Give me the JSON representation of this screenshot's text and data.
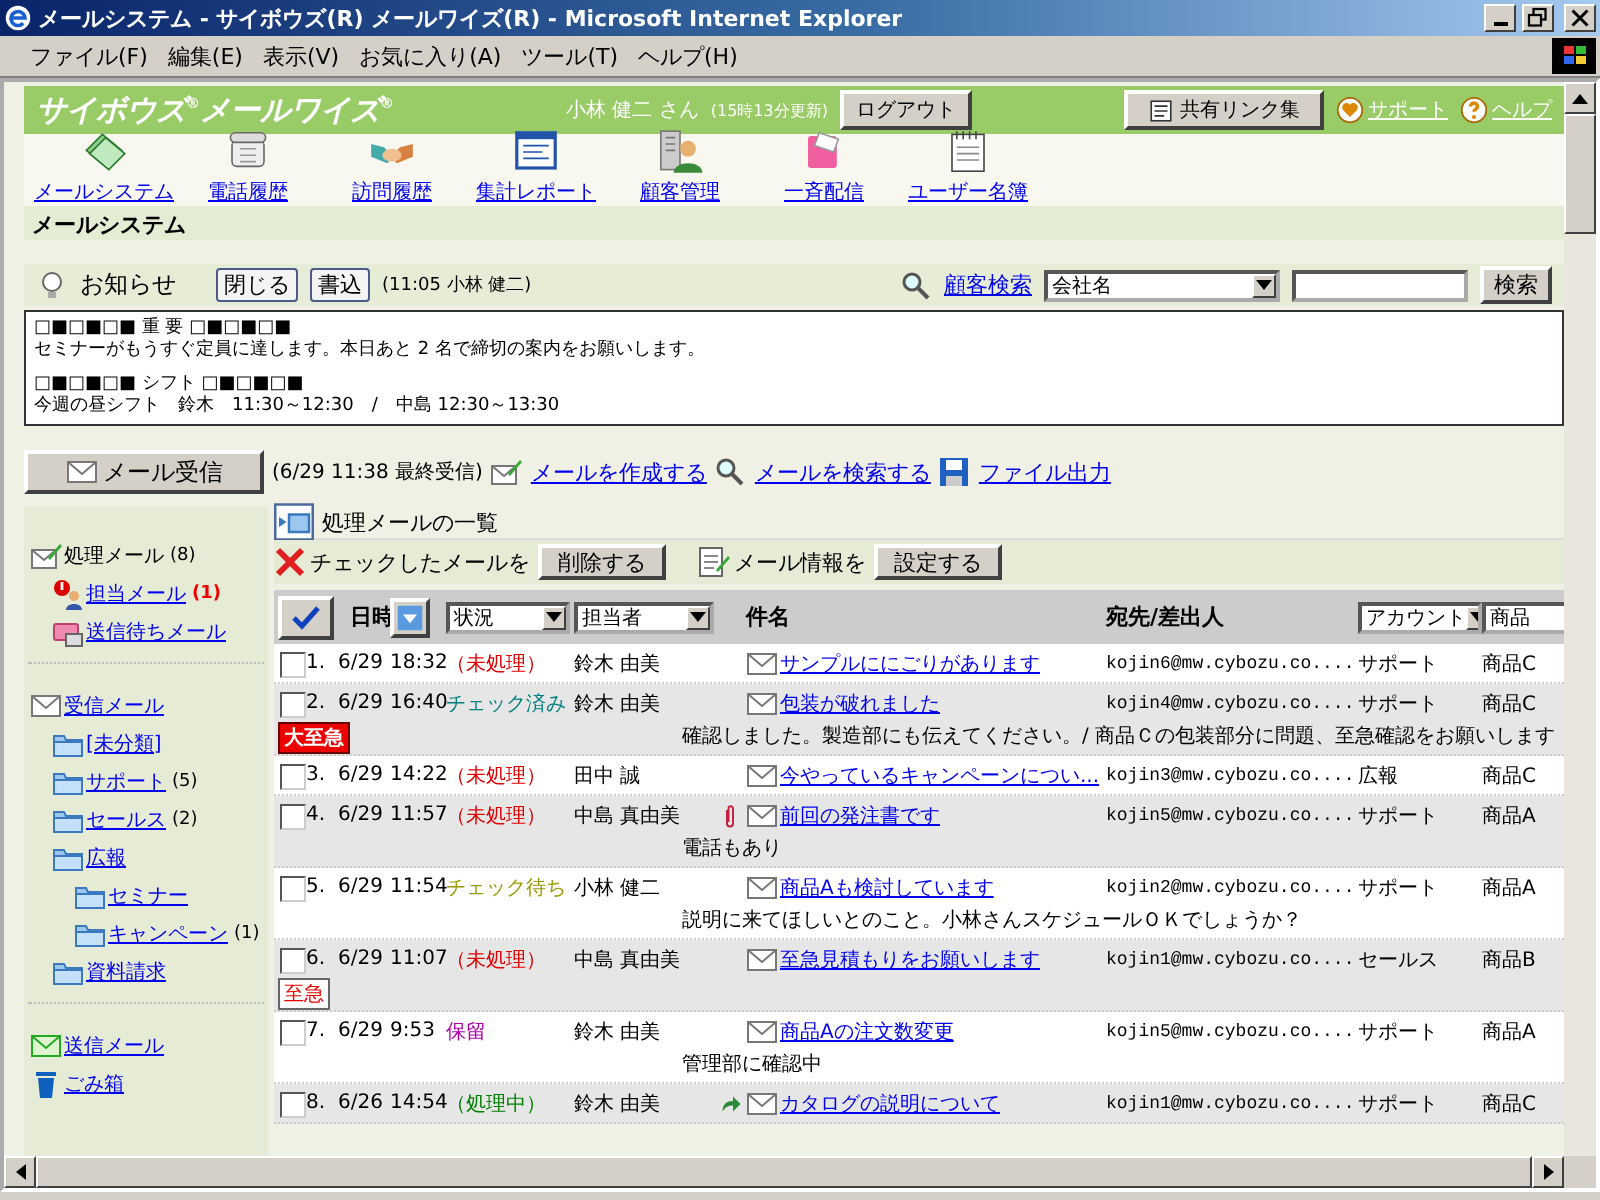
{
  "window": {
    "title": "メールシステム - サイボウズ(R) メールワイズ(R) - Microsoft Internet Explorer"
  },
  "menu": [
    "ファイル(F)",
    "編集(E)",
    "表示(V)",
    "お気に入り(A)",
    "ツール(T)",
    "ヘルプ(H)"
  ],
  "header": {
    "logo": "サイボウズ$^{®}$メールワイズ$^{®}$",
    "user": "小林 健二 さん",
    "updated": "(15時13分更新)",
    "logout": "ログアウト",
    "shared_links": "共有リンク集",
    "support": "サポート",
    "help": "ヘルプ"
  },
  "nav": [
    {
      "label": "メールシステム",
      "kind": "mail"
    },
    {
      "label": "電話履歴",
      "kind": "phone"
    },
    {
      "label": "訪問履歴",
      "kind": "visit"
    },
    {
      "label": "集計レポート",
      "kind": "report"
    },
    {
      "label": "顧客管理",
      "kind": "customer"
    },
    {
      "label": "一斉配信",
      "kind": "broadcast"
    },
    {
      "label": "ユーザー名簿",
      "kind": "users"
    }
  ],
  "section_title": "メールシステム",
  "notice": {
    "title": "お知らせ",
    "close": "閉じる",
    "write": "書込",
    "meta": "(11:05 小林 健二)",
    "paragraphs": [
      [
        "□■□■□■ 重 要 □■□■□■",
        "セミナーがもうすぐ定員に達します。本日あと 2 名で締切の案内をお願いします。"
      ],
      [
        "□■□■□■ シフト □■□■□■",
        "今週の昼シフト　鈴木　11:30～12:30　/　中島 12:30～13:30"
      ]
    ]
  },
  "customer_search": {
    "link": "顧客検索",
    "select": "会社名",
    "button": "検索"
  },
  "actions": {
    "receive": "メール受信",
    "last_received": "(6/29 11:38 最終受信)",
    "compose": "メールを作成する",
    "search": "メールを検索する",
    "export": "ファイル出力"
  },
  "sidebar": {
    "sections": [
      {
        "items": [
          {
            "label": "処理メール",
            "count": "(8)",
            "alert": false,
            "kind": "mail-pen",
            "link": false,
            "children": [
              {
                "label": "担当メール",
                "count": "(1)",
                "alert": true,
                "kind": "person-alert",
                "link": true
              },
              {
                "label": "送信待ちメール",
                "kind": "outbox",
                "link": true
              }
            ]
          }
        ]
      },
      {
        "items": [
          {
            "label": "受信メール",
            "kind": "envelope",
            "link": true,
            "children": [
              {
                "label": "[未分類]",
                "kind": "folder",
                "link": true
              },
              {
                "label": "サポート",
                "count": "(5)",
                "alert": false,
                "kind": "folder",
                "link": true
              },
              {
                "label": "セールス",
                "count": "(2)",
                "alert": false,
                "kind": "folder",
                "link": true
              },
              {
                "label": "広報",
                "kind": "folder",
                "link": true,
                "children": [
                  {
                    "label": "セミナー",
                    "kind": "folder",
                    "link": true
                  },
                  {
                    "label": "キャンペーン",
                    "count": "(1)",
                    "alert": false,
                    "kind": "folder",
                    "link": true
                  }
                ]
              },
              {
                "label": "資料請求",
                "kind": "folder",
                "link": true
              }
            ]
          }
        ]
      },
      {
        "items": [
          {
            "label": "送信メール",
            "kind": "envelope-green",
            "link": true
          },
          {
            "label": "ごみ箱",
            "kind": "trash",
            "link": true
          }
        ]
      }
    ]
  },
  "list": {
    "title": "処理メールの一覧",
    "delete_prefix": "チェックしたメールを",
    "delete_button": "削除する",
    "info_prefix": "メール情報を",
    "set_button": "設定する",
    "columns": {
      "date": "日時",
      "status": "状況",
      "assignee": "担当者",
      "subject": "件名",
      "address": "宛先/差出人",
      "account": "アカウント",
      "product": "商品"
    },
    "rows": [
      {
        "no": "1.",
        "checked": false,
        "date": "6/29",
        "time": "18:32",
        "status": {
          "label": "（未処理）",
          "color": "#e00000"
        },
        "assignee": "鈴木 由美",
        "attachment": false,
        "forwarded": false,
        "subject": "サンプルににごりがあります",
        "address": "kojin6@mw.cybozu.co....",
        "account": "サポート",
        "product": "商品C"
      },
      {
        "no": "2.",
        "checked": false,
        "date": "6/29",
        "time": "16:40",
        "status": {
          "label": "チェック済み",
          "color": "#008080"
        },
        "assignee": "鈴木 由美",
        "attachment": false,
        "forwarded": false,
        "subject": "包装が破れました",
        "address": "kojin4@mw.cybozu.co....",
        "account": "サポート",
        "product": "商品C",
        "memo": "確認しました。製造部にも伝えてください。/ 商品Ｃの包装部分に問題、至急確認をお願いします",
        "badge": {
          "label": "大至急",
          "kind": "top"
        }
      },
      {
        "no": "3.",
        "checked": false,
        "date": "6/29",
        "time": "14:22",
        "status": {
          "label": "（未処理）",
          "color": "#e00000"
        },
        "assignee": "田中 誠",
        "attachment": false,
        "forwarded": false,
        "subject": "今やっているキャンペーンについ...",
        "address": "kojin3@mw.cybozu.co....",
        "account": "広報",
        "product": "商品C"
      },
      {
        "no": "4.",
        "checked": false,
        "date": "6/29",
        "time": "11:57",
        "status": {
          "label": "（未処理）",
          "color": "#e00000"
        },
        "assignee": "中島 真由美",
        "attachment": true,
        "forwarded": false,
        "subject": "前回の発注書です",
        "address": "kojin5@mw.cybozu.co....",
        "account": "サポート",
        "product": "商品A",
        "memo": "電話もあり"
      },
      {
        "no": "5.",
        "checked": false,
        "date": "6/29",
        "time": "11:54",
        "status": {
          "label": "チェック待ち",
          "color": "#999900"
        },
        "assignee": "小林 健二",
        "attachment": false,
        "forwarded": false,
        "subject": "商品Aも検討しています",
        "address": "kojin2@mw.cybozu.co....",
        "account": "サポート",
        "product": "商品A",
        "memo": "説明に来てほしいとのこと。小林さんスケジュールＯＫでしょうか？"
      },
      {
        "no": "6.",
        "checked": false,
        "date": "6/29",
        "time": "11:07",
        "status": {
          "label": "（未処理）",
          "color": "#e00000"
        },
        "assignee": "中島 真由美",
        "attachment": false,
        "forwarded": false,
        "subject": "至急見積もりをお願いします",
        "address": "kojin1@mw.cybozu.co....",
        "account": "セールス",
        "product": "商品B",
        "badge": {
          "label": "至急",
          "kind": "normal"
        }
      },
      {
        "no": "7.",
        "checked": false,
        "date": "6/29",
        "time": "9:53",
        "status": {
          "label": "保留",
          "color": "#aa00aa"
        },
        "assignee": "鈴木 由美",
        "attachment": false,
        "forwarded": false,
        "subject": "商品Aの注文数変更",
        "address": "kojin5@mw.cybozu.co....",
        "account": "サポート",
        "product": "商品A",
        "memo": "管理部に確認中"
      },
      {
        "no": "8.",
        "checked": false,
        "date": "6/26",
        "time": "14:54",
        "status": {
          "label": "（処理中）",
          "color": "#008000"
        },
        "assignee": "鈴木 由美",
        "attachment": false,
        "forwarded": true,
        "subject": "カタログの説明について",
        "address": "kojin1@mw.cybozu.co....",
        "account": "サポート",
        "product": "商品C"
      }
    ]
  }
}
